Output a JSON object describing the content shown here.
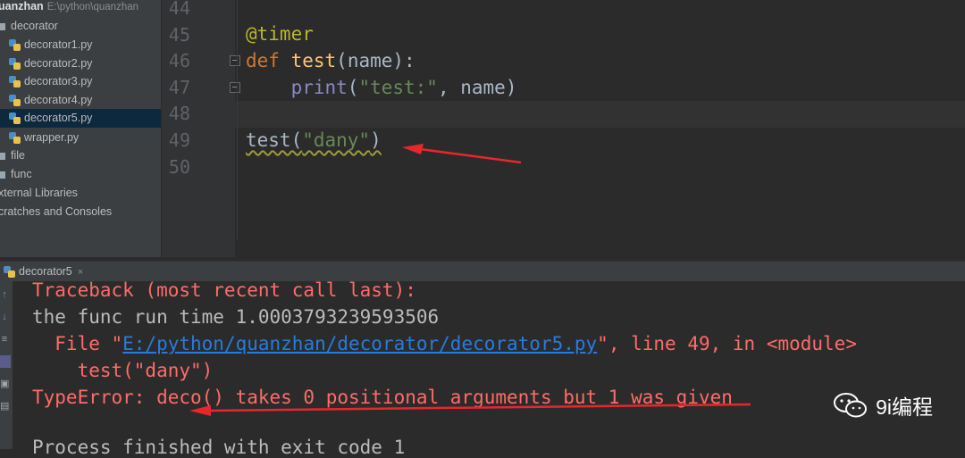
{
  "sidebar": {
    "root": {
      "name": "uanzhan",
      "path": "E:\\python\\quanzhan"
    },
    "items": [
      {
        "label": "decorator",
        "type": "folder"
      },
      {
        "label": "decorator1.py",
        "type": "py"
      },
      {
        "label": "decorator2.py",
        "type": "py"
      },
      {
        "label": "decorator3.py",
        "type": "py"
      },
      {
        "label": "decorator4.py",
        "type": "py"
      },
      {
        "label": "decorator5.py",
        "type": "py",
        "selected": true
      },
      {
        "label": "wrapper.py",
        "type": "py"
      },
      {
        "label": "file",
        "type": "folder"
      },
      {
        "label": "func",
        "type": "folder"
      },
      {
        "label": "xternal Libraries",
        "type": "lib"
      },
      {
        "label": "cratches and Consoles",
        "type": "lib"
      }
    ]
  },
  "editor": {
    "line_numbers": [
      "44",
      "45",
      "46",
      "47",
      "48",
      "49",
      "50"
    ],
    "code": {
      "l45_decorator": "@timer",
      "l46_def": "def",
      "l46_name": "test",
      "l46_rest": "(name):",
      "l47_indent": "    ",
      "l47_print": "print",
      "l47_open": "(",
      "l47_str": "\"test:\"",
      "l47_rest": ", name)",
      "l49_call": "test(",
      "l49_str": "\"dany\"",
      "l49_close": ")"
    }
  },
  "run_panel": {
    "tab_label": "decorator5",
    "tab_close": "×",
    "console": {
      "line1": "Traceback (most recent call last):",
      "line2": "the func run time 1.0003793239593506",
      "line3_prefix": "  File \"",
      "line3_link": "E:/python/quanzhan/decorator/decorator5.py",
      "line3_suffix": "\", line 49, in <module>",
      "line4": "    test(\"dany\")",
      "line5": "TypeError: deco() takes 0 positional arguments but 1 was given",
      "line6": "Process finished with exit code 1"
    }
  },
  "watermark": {
    "text": "9i编程"
  },
  "colors": {
    "error": "#ff6b68",
    "link": "#287bde",
    "arrow": "#e8262e"
  }
}
